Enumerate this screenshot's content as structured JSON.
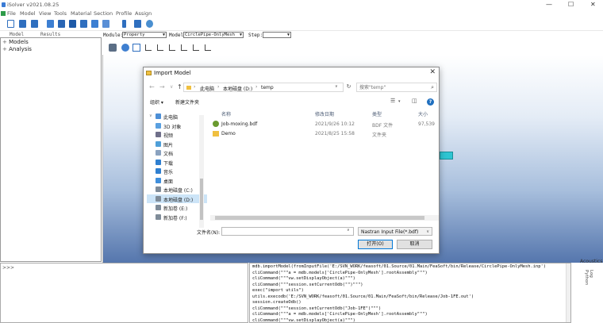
{
  "app": {
    "title": "iSolver v2021.08.25",
    "window_controls": {
      "minimize": "—",
      "maximize": "☐",
      "close": "✕"
    }
  },
  "menu": [
    "File",
    "Model",
    "View",
    "Tools",
    "Material",
    "Section",
    "Profile",
    "Assign"
  ],
  "left_panel": {
    "tabs": [
      "Model",
      "Results"
    ],
    "tree": [
      {
        "expander": "+",
        "label": "Models"
      },
      {
        "expander": "+",
        "label": "Analysis"
      }
    ]
  },
  "module_bar": {
    "module_label": "Module:",
    "module_value": "Property",
    "model_label": "Model:",
    "model_value": "CirclePipe-OnlyMesh",
    "step_label": "Step:",
    "step_value": ""
  },
  "command": {
    "prompt": ">>>"
  },
  "log_lines": [
    "mdb.importModel(fromInputFile('E:/SVN_WORK/feasoft/01.Source/01.Main/FeaSoft/bin/Release/CirclePipe-OnlyMesh.inp')",
    "cliCommand(\"\"\"a = mdb.models['CirclePipe-OnlyMesh'].rootAssembly\"\"\")",
    "cliCommand(\"\"\"vw.setDisplayObject(a)\"\"\")",
    "cliCommand(\"\"\"session.setCurrentOdb(\"\")\"\"\")",
    "exec(\"import utils\")",
    "utils.execodb('E:/SVN_WORK/feasoft/01.Source/01.Main/FeaSoft/bin/Release/Job-1FE.out')",
    "session.createOdb()",
    "cliCommand(\"\"\"session.setCurrentOdb(\"Job-1FE\")\"\"\")",
    "cliCommand(\"\"\"a = mdb.models['CirclePipe-OnlyMesh'].rootAssembly\"\"\")",
    "cliCommand(\"\"\"vw.setDisplayObject(a)\"\"\")"
  ],
  "right_labels": {
    "acoustics": "Acoustics",
    "side_tab": "Log Python"
  },
  "dialog": {
    "title": "Import Model",
    "close": "✕",
    "breadcrumb": [
      "此电脑",
      "本地磁盘 (D:)",
      "temp"
    ],
    "search_placeholder": "搜索\"temp\"",
    "organize": "组织 ▾",
    "new_folder": "新建文件夹",
    "nav_items": [
      {
        "label": "此电脑",
        "icon": "computer-icon",
        "color": "#4d8fd6"
      },
      {
        "label": "3D 对象",
        "icon": "3d-objects-icon",
        "color": "#5aa0e0"
      },
      {
        "label": "视频",
        "icon": "video-icon",
        "color": "#6f6f8a"
      },
      {
        "label": "图片",
        "icon": "pictures-icon",
        "color": "#4f9fd8"
      },
      {
        "label": "文档",
        "icon": "documents-icon",
        "color": "#8aa2bf"
      },
      {
        "label": "下载",
        "icon": "downloads-icon",
        "color": "#2f7fd0"
      },
      {
        "label": "音乐",
        "icon": "music-icon",
        "color": "#2f7fd0"
      },
      {
        "label": "桌面",
        "icon": "desktop-icon",
        "color": "#3f8fdc"
      },
      {
        "label": "本地磁盘 (C:)",
        "icon": "drive-icon",
        "color": "#7f8c99"
      },
      {
        "label": "本地磁盘 (D:)",
        "icon": "drive-icon",
        "color": "#7f8c99"
      },
      {
        "label": "新加卷 (E:)",
        "icon": "drive-icon",
        "color": "#7f8c99"
      },
      {
        "label": "新加卷 (F:)",
        "icon": "drive-icon",
        "color": "#7f8c99"
      }
    ],
    "columns": [
      "名称",
      "修改日期",
      "类型",
      "大小"
    ],
    "files": [
      {
        "name": "Job-moxing.bdf",
        "date": "2021/9/26 10:12",
        "type": "BDF 文件",
        "size": "97,539",
        "icon": "bdf-file-icon"
      },
      {
        "name": "Demo",
        "date": "2021/8/25 15:58",
        "type": "文件夹",
        "size": "",
        "icon": "folder-icon"
      }
    ],
    "filename_label": "文件名(N):",
    "filename_value": "",
    "filetype": "Nastran Input File(*.bdf)",
    "open_button": "打开(O)",
    "cancel_button": "取消"
  },
  "colors": {
    "mesh": "#2ec5d2",
    "viewport_bottom": "#5576ad",
    "selection": "#cce4f7"
  }
}
